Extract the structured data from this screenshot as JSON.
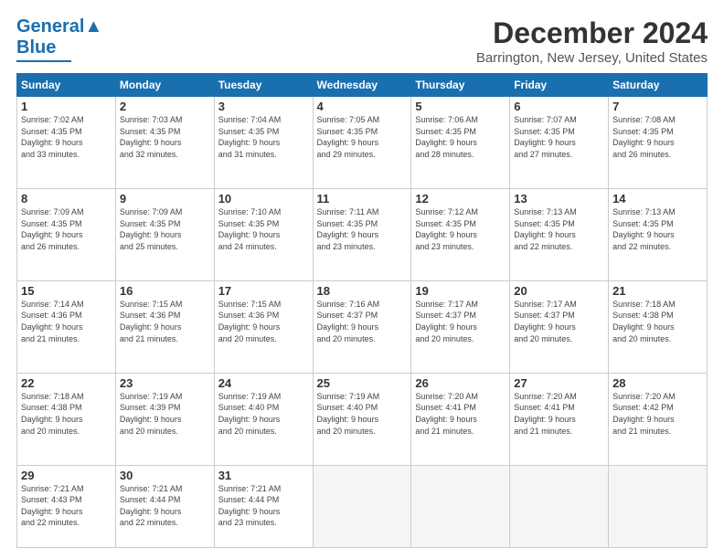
{
  "logo": {
    "text1": "General",
    "text2": "Blue"
  },
  "header": {
    "month": "December 2024",
    "location": "Barrington, New Jersey, United States"
  },
  "weekdays": [
    "Sunday",
    "Monday",
    "Tuesday",
    "Wednesday",
    "Thursday",
    "Friday",
    "Saturday"
  ],
  "weeks": [
    [
      {
        "day": "1",
        "info": "Sunrise: 7:02 AM\nSunset: 4:35 PM\nDaylight: 9 hours\nand 33 minutes."
      },
      {
        "day": "2",
        "info": "Sunrise: 7:03 AM\nSunset: 4:35 PM\nDaylight: 9 hours\nand 32 minutes."
      },
      {
        "day": "3",
        "info": "Sunrise: 7:04 AM\nSunset: 4:35 PM\nDaylight: 9 hours\nand 31 minutes."
      },
      {
        "day": "4",
        "info": "Sunrise: 7:05 AM\nSunset: 4:35 PM\nDaylight: 9 hours\nand 29 minutes."
      },
      {
        "day": "5",
        "info": "Sunrise: 7:06 AM\nSunset: 4:35 PM\nDaylight: 9 hours\nand 28 minutes."
      },
      {
        "day": "6",
        "info": "Sunrise: 7:07 AM\nSunset: 4:35 PM\nDaylight: 9 hours\nand 27 minutes."
      },
      {
        "day": "7",
        "info": "Sunrise: 7:08 AM\nSunset: 4:35 PM\nDaylight: 9 hours\nand 26 minutes."
      }
    ],
    [
      {
        "day": "8",
        "info": "Sunrise: 7:09 AM\nSunset: 4:35 PM\nDaylight: 9 hours\nand 26 minutes."
      },
      {
        "day": "9",
        "info": "Sunrise: 7:09 AM\nSunset: 4:35 PM\nDaylight: 9 hours\nand 25 minutes."
      },
      {
        "day": "10",
        "info": "Sunrise: 7:10 AM\nSunset: 4:35 PM\nDaylight: 9 hours\nand 24 minutes."
      },
      {
        "day": "11",
        "info": "Sunrise: 7:11 AM\nSunset: 4:35 PM\nDaylight: 9 hours\nand 23 minutes."
      },
      {
        "day": "12",
        "info": "Sunrise: 7:12 AM\nSunset: 4:35 PM\nDaylight: 9 hours\nand 23 minutes."
      },
      {
        "day": "13",
        "info": "Sunrise: 7:13 AM\nSunset: 4:35 PM\nDaylight: 9 hours\nand 22 minutes."
      },
      {
        "day": "14",
        "info": "Sunrise: 7:13 AM\nSunset: 4:35 PM\nDaylight: 9 hours\nand 22 minutes."
      }
    ],
    [
      {
        "day": "15",
        "info": "Sunrise: 7:14 AM\nSunset: 4:36 PM\nDaylight: 9 hours\nand 21 minutes."
      },
      {
        "day": "16",
        "info": "Sunrise: 7:15 AM\nSunset: 4:36 PM\nDaylight: 9 hours\nand 21 minutes."
      },
      {
        "day": "17",
        "info": "Sunrise: 7:15 AM\nSunset: 4:36 PM\nDaylight: 9 hours\nand 20 minutes."
      },
      {
        "day": "18",
        "info": "Sunrise: 7:16 AM\nSunset: 4:37 PM\nDaylight: 9 hours\nand 20 minutes."
      },
      {
        "day": "19",
        "info": "Sunrise: 7:17 AM\nSunset: 4:37 PM\nDaylight: 9 hours\nand 20 minutes."
      },
      {
        "day": "20",
        "info": "Sunrise: 7:17 AM\nSunset: 4:37 PM\nDaylight: 9 hours\nand 20 minutes."
      },
      {
        "day": "21",
        "info": "Sunrise: 7:18 AM\nSunset: 4:38 PM\nDaylight: 9 hours\nand 20 minutes."
      }
    ],
    [
      {
        "day": "22",
        "info": "Sunrise: 7:18 AM\nSunset: 4:38 PM\nDaylight: 9 hours\nand 20 minutes."
      },
      {
        "day": "23",
        "info": "Sunrise: 7:19 AM\nSunset: 4:39 PM\nDaylight: 9 hours\nand 20 minutes."
      },
      {
        "day": "24",
        "info": "Sunrise: 7:19 AM\nSunset: 4:40 PM\nDaylight: 9 hours\nand 20 minutes."
      },
      {
        "day": "25",
        "info": "Sunrise: 7:19 AM\nSunset: 4:40 PM\nDaylight: 9 hours\nand 20 minutes."
      },
      {
        "day": "26",
        "info": "Sunrise: 7:20 AM\nSunset: 4:41 PM\nDaylight: 9 hours\nand 21 minutes."
      },
      {
        "day": "27",
        "info": "Sunrise: 7:20 AM\nSunset: 4:41 PM\nDaylight: 9 hours\nand 21 minutes."
      },
      {
        "day": "28",
        "info": "Sunrise: 7:20 AM\nSunset: 4:42 PM\nDaylight: 9 hours\nand 21 minutes."
      }
    ],
    [
      {
        "day": "29",
        "info": "Sunrise: 7:21 AM\nSunset: 4:43 PM\nDaylight: 9 hours\nand 22 minutes."
      },
      {
        "day": "30",
        "info": "Sunrise: 7:21 AM\nSunset: 4:44 PM\nDaylight: 9 hours\nand 22 minutes."
      },
      {
        "day": "31",
        "info": "Sunrise: 7:21 AM\nSunset: 4:44 PM\nDaylight: 9 hours\nand 23 minutes."
      },
      {
        "day": "",
        "info": ""
      },
      {
        "day": "",
        "info": ""
      },
      {
        "day": "",
        "info": ""
      },
      {
        "day": "",
        "info": ""
      }
    ]
  ]
}
